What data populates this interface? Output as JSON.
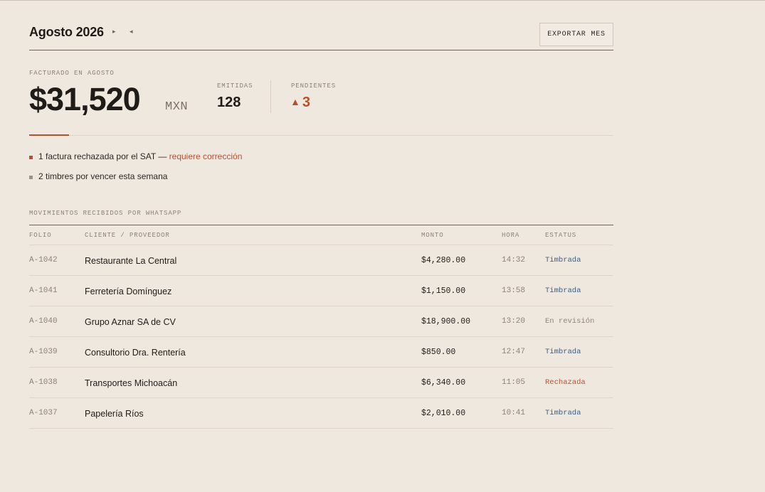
{
  "header": {
    "title": "Agosto 2026",
    "next_icon": "▸",
    "prev_icon": "◂",
    "export_label": "EXPORTAR MES"
  },
  "summary": {
    "facturado_label": "FACTURADO EN AGOSTO",
    "facturado_amount": "$31,520",
    "currency": "MXN",
    "emitidas_label": "EMITIDAS",
    "emitidas_value": "128",
    "pendientes_label": "PENDIENTES",
    "pendientes_icon": "▲",
    "pendientes_value": "3"
  },
  "alerts": [
    {
      "text": "1 factura rechazada por el SAT — ",
      "link": "requiere corrección",
      "color": "#b8502f"
    },
    {
      "text": "2 timbres por vencer esta semana",
      "link": "",
      "color": "#9b938a"
    }
  ],
  "movimientos": {
    "section_label": "MOVIMIENTOS RECIBIDOS POR WHATSAPP",
    "columns": [
      "FOLIO",
      "CLIENTE / PROVEEDOR",
      "MONTO",
      "HORA",
      "ESTATUS"
    ],
    "rows": [
      {
        "folio": "A-1042",
        "cliente": "Restaurante La Central",
        "monto": "$4,280.00",
        "hora": "14:32",
        "estatus": "Timbrada",
        "status_color": "#3c5f86"
      },
      {
        "folio": "A-1041",
        "cliente": "Ferretería Domínguez",
        "monto": "$1,150.00",
        "hora": "13:58",
        "estatus": "Timbrada",
        "status_color": "#3c5f86"
      },
      {
        "folio": "A-1040",
        "cliente": "Grupo Aznar SA de CV",
        "monto": "$18,900.00",
        "hora": "13:20",
        "estatus": "En revisión",
        "status_color": "#8b837a"
      },
      {
        "folio": "A-1039",
        "cliente": "Consultorio Dra. Rentería",
        "monto": "$850.00",
        "hora": "12:47",
        "estatus": "Timbrada",
        "status_color": "#3c5f86"
      },
      {
        "folio": "A-1038",
        "cliente": "Transportes Michoacán",
        "monto": "$6,340.00",
        "hora": "11:05",
        "estatus": "Rechazada",
        "status_color": "#b8502f"
      },
      {
        "folio": "A-1037",
        "cliente": "Papelería Ríos",
        "monto": "$2,010.00",
        "hora": "10:41",
        "estatus": "Timbrada",
        "status_color": "#3c5f86"
      }
    ]
  },
  "colors": {
    "background": "#efe8df",
    "accent": "#b8502f",
    "status_timbrada": "#3c5f86",
    "muted": "#8b837a"
  }
}
